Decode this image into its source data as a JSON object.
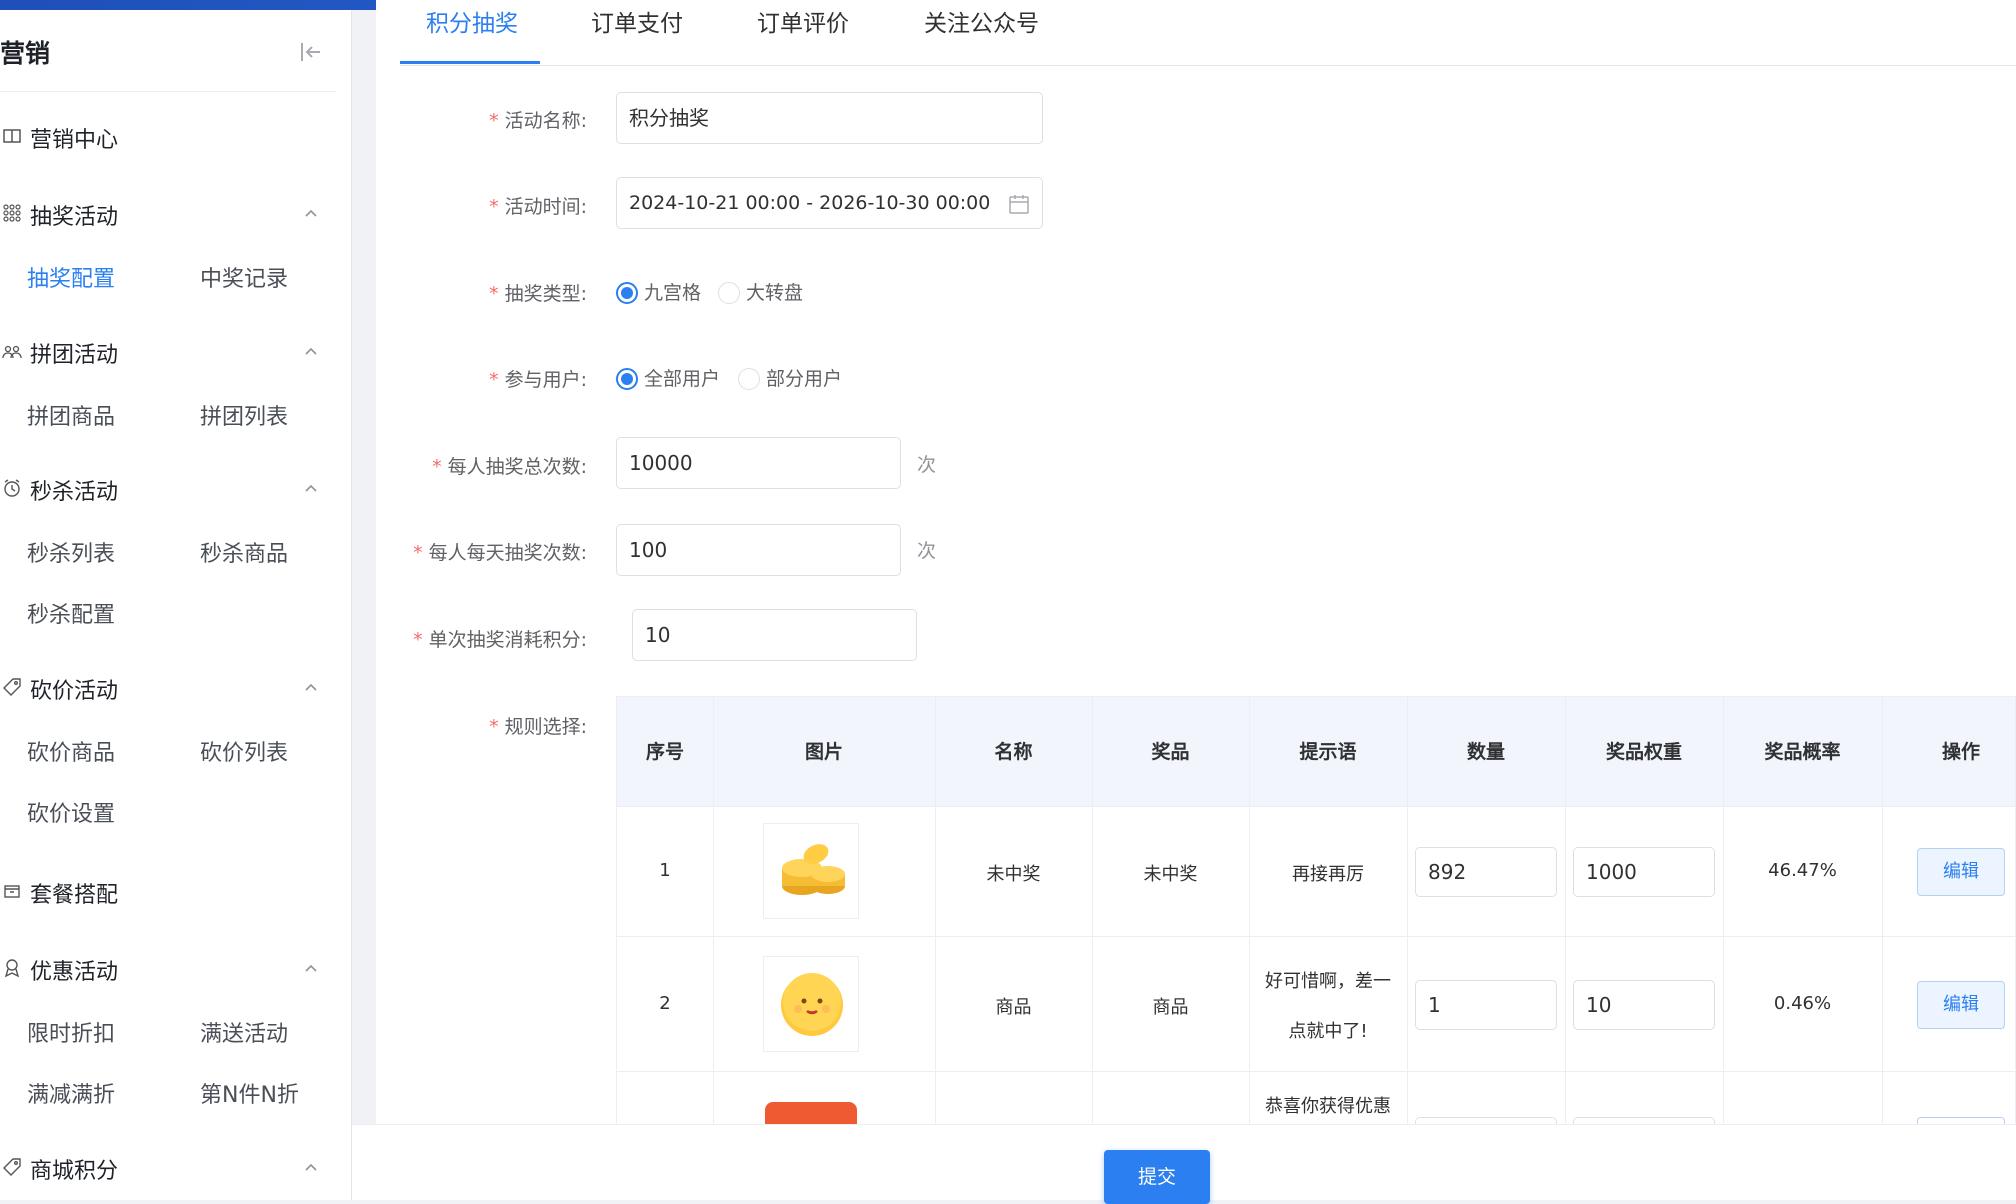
{
  "sidebar": {
    "title": "营销",
    "sections": [
      {
        "label": "营销中心",
        "icon": "book-icon"
      },
      {
        "label": "抽奖活动",
        "icon": "grid-icon",
        "items": [
          "抽奖配置",
          "中奖记录"
        ]
      },
      {
        "label": "拼团活动",
        "icon": "group-icon",
        "items": [
          "拼团商品",
          "拼团列表"
        ]
      },
      {
        "label": "秒杀活动",
        "icon": "alarm-icon",
        "items": [
          "秒杀列表",
          "秒杀商品",
          "秒杀配置"
        ]
      },
      {
        "label": "砍价活动",
        "icon": "tag-icon",
        "items": [
          "砍价商品",
          "砍价列表",
          "砍价设置"
        ]
      },
      {
        "label": "套餐搭配",
        "icon": "box-icon"
      },
      {
        "label": "优惠活动",
        "icon": "award-icon",
        "items": [
          "限时折扣",
          "满送活动",
          "满减满折",
          "第N件N折"
        ]
      },
      {
        "label": "商城积分",
        "icon": "tag-icon"
      }
    ]
  },
  "tabs": [
    "积分抽奖",
    "订单支付",
    "订单评价",
    "关注公众号"
  ],
  "form": {
    "name_label": "活动名称:",
    "name_value": "积分抽奖",
    "time_label": "活动时间:",
    "time_value": "2024-10-21 00:00 - 2026-10-30 00:00",
    "type_label": "抽奖类型:",
    "type_options": [
      "九宫格",
      "大转盘"
    ],
    "type_selected": "九宫格",
    "users_label": "参与用户:",
    "users_options": [
      "全部用户",
      "部分用户"
    ],
    "users_selected": "全部用户",
    "total_label": "每人抽奖总次数:",
    "total_value": "10000",
    "daily_label": "每人每天抽奖次数:",
    "daily_value": "100",
    "cost_label": "单次抽奖消耗积分:",
    "cost_value": "10",
    "unit": "次",
    "rules_label": "规则选择:"
  },
  "table": {
    "headers": [
      "序号",
      "图片",
      "名称",
      "奖品",
      "提示语",
      "数量",
      "奖品权重",
      "奖品概率",
      "操作"
    ],
    "rows": [
      {
        "index": "1",
        "image": "gold-coins-image",
        "name": "未中奖",
        "prize": "未中奖",
        "hint": "再接再厉",
        "qty": "892",
        "weight": "1000",
        "prob": "46.47%",
        "action": "编辑"
      },
      {
        "index": "2",
        "image": "smiley-face-image",
        "name": "商品",
        "prize": "商品",
        "hint_line1": "好可惜啊，差一",
        "hint_line2": "点就中了!",
        "qty": "1",
        "weight": "10",
        "prob": "0.46%",
        "action": "编辑"
      },
      {
        "image": "coupon-image",
        "hint": "恭喜你获得优惠"
      }
    ]
  },
  "submit_label": "提交",
  "colors": {
    "accent": "#2b7ff0",
    "required": "#f56c6c"
  }
}
